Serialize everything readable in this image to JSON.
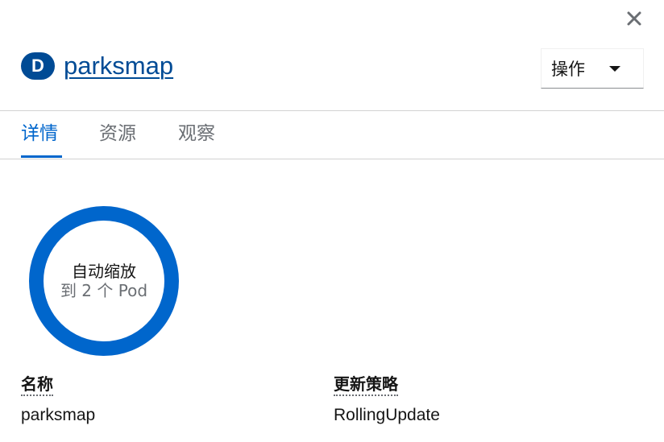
{
  "header": {
    "badge": "D",
    "title": "parksmap",
    "actions_label": "操作"
  },
  "tabs": [
    {
      "label": "详情",
      "active": true
    },
    {
      "label": "资源",
      "active": false
    },
    {
      "label": "观察",
      "active": false
    }
  ],
  "donut": {
    "line1": "自动缩放",
    "line2": "到 2 个 Pod",
    "color": "#0066cc"
  },
  "details": {
    "name_label": "名称",
    "name_value": "parksmap",
    "strategy_label": "更新策略",
    "strategy_value": "RollingUpdate"
  },
  "icons": {
    "close": "close-icon",
    "caret": "caret-down-icon"
  }
}
